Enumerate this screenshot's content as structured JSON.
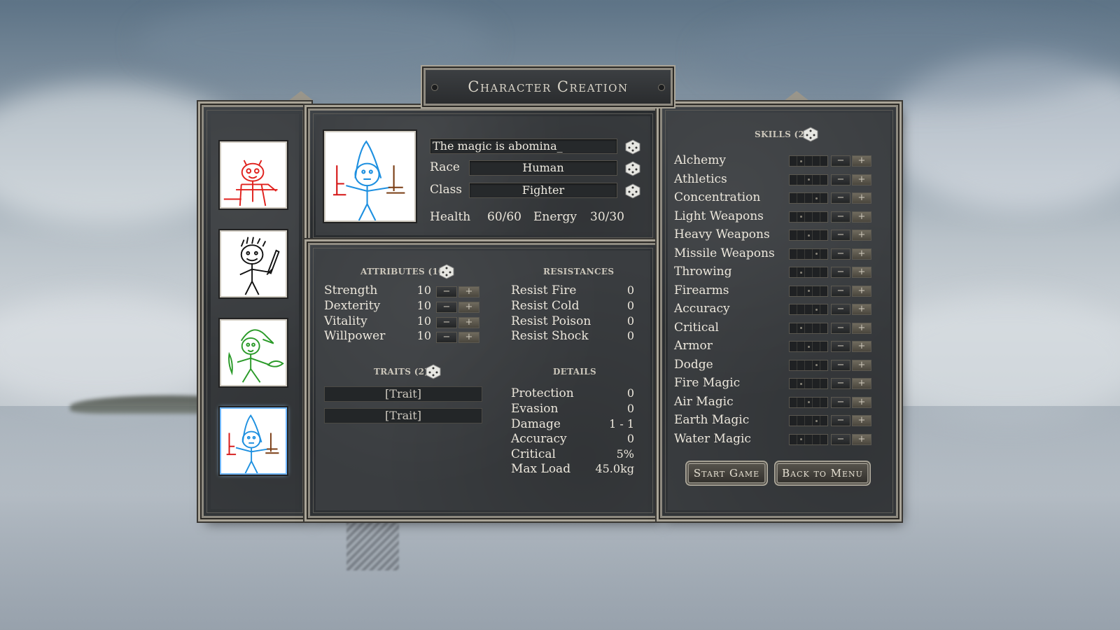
{
  "title": "Character Creation",
  "portraits": [
    {
      "name": "red-devil-portrait"
    },
    {
      "name": "black-warrior-portrait"
    },
    {
      "name": "green-goblin-portrait"
    },
    {
      "name": "blue-wizard-portrait",
      "selected": true
    }
  ],
  "character": {
    "name_value": "The magic is abomina_",
    "race_label": "Race",
    "race_value": "Human",
    "class_label": "Class",
    "class_value": "Fighter",
    "health_label": "Health",
    "health_value": "60/60",
    "energy_label": "Energy",
    "energy_value": "30/30"
  },
  "attributes": {
    "header": "ATTRIBUTES (10)",
    "items": [
      {
        "label": "Strength",
        "value": "10"
      },
      {
        "label": "Dexterity",
        "value": "10"
      },
      {
        "label": "Vitality",
        "value": "10"
      },
      {
        "label": "Willpower",
        "value": "10"
      }
    ]
  },
  "resistances": {
    "header": "RESISTANCES",
    "items": [
      {
        "label": "Resist Fire",
        "value": "0"
      },
      {
        "label": "Resist Cold",
        "value": "0"
      },
      {
        "label": "Resist Poison",
        "value": "0"
      },
      {
        "label": "Resist Shock",
        "value": "0"
      }
    ]
  },
  "traits": {
    "header": "TRAITS (2)",
    "items": [
      "[Trait]",
      "[Trait]"
    ]
  },
  "details": {
    "header": "DETAILS",
    "items": [
      {
        "label": "Protection",
        "value": "0"
      },
      {
        "label": "Evasion",
        "value": "0"
      },
      {
        "label": "Damage",
        "value": "1 - 1"
      },
      {
        "label": "Accuracy",
        "value": "0"
      },
      {
        "label": "Critical",
        "value": "5%"
      },
      {
        "label": "Max Load",
        "value": "45.0kg"
      }
    ]
  },
  "skills": {
    "header": "SKILLS (2)",
    "items": [
      {
        "label": "Alchemy",
        "level": 0
      },
      {
        "label": "Athletics",
        "level": 0
      },
      {
        "label": "Concentration",
        "level": 0
      },
      {
        "label": "Light Weapons",
        "level": 0
      },
      {
        "label": "Heavy Weapons",
        "level": 0
      },
      {
        "label": "Missile Weapons",
        "level": 0
      },
      {
        "label": "Throwing",
        "level": 0
      },
      {
        "label": "Firearms",
        "level": 0
      },
      {
        "label": "Accuracy",
        "level": 0
      },
      {
        "label": "Critical",
        "level": 0
      },
      {
        "label": "Armor",
        "level": 0
      },
      {
        "label": "Dodge",
        "level": 0
      },
      {
        "label": "Fire Magic",
        "level": 0
      },
      {
        "label": "Air Magic",
        "level": 0
      },
      {
        "label": "Earth Magic",
        "level": 0
      },
      {
        "label": "Water Magic",
        "level": 0
      }
    ]
  },
  "buttons": {
    "start": "Start Game",
    "back": "Back to Menu"
  },
  "controls": {
    "minus": "−",
    "plus": "+"
  }
}
